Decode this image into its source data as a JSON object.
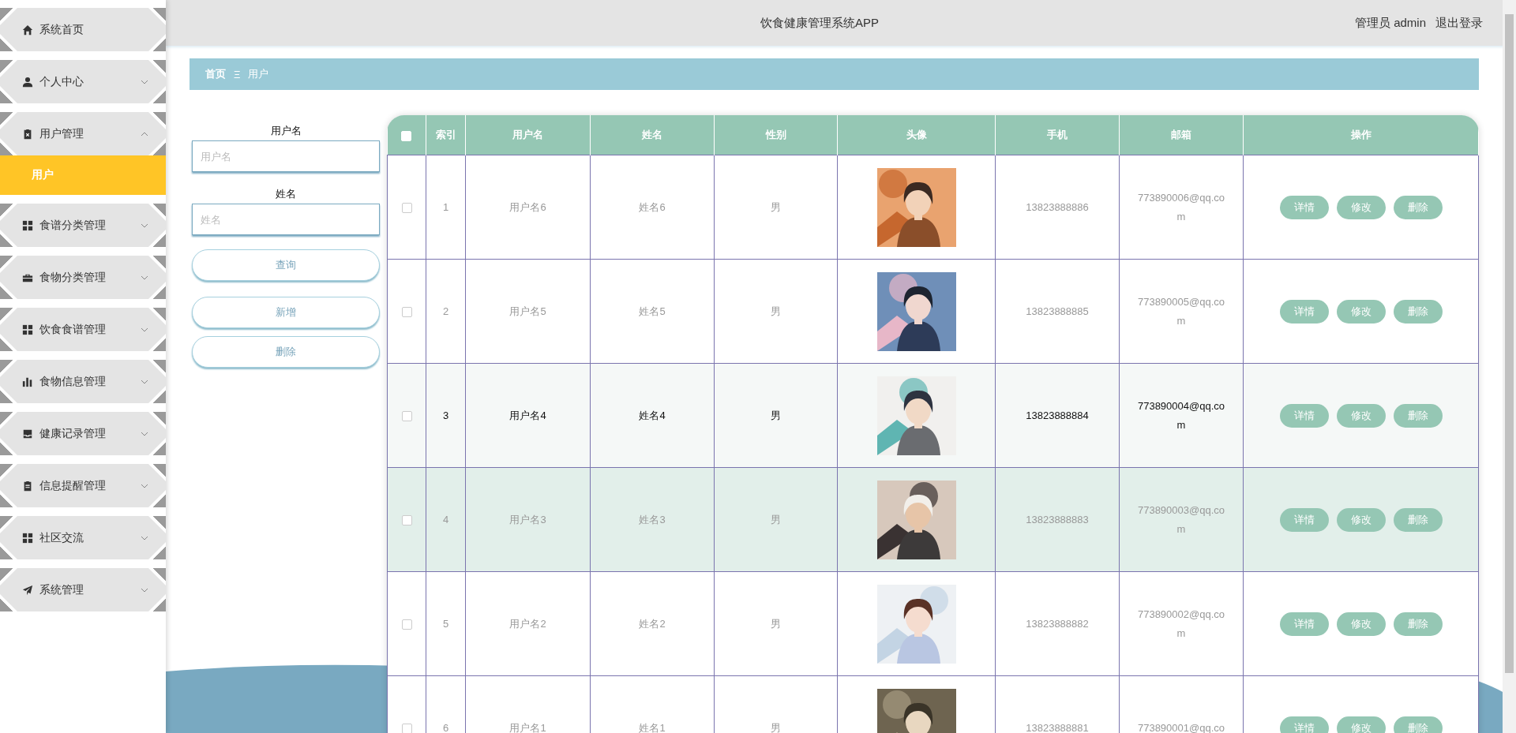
{
  "sidebar": {
    "items": [
      {
        "label": "系统首页",
        "kind": "link"
      },
      {
        "label": "个人中心",
        "kind": "group",
        "expanded": false
      },
      {
        "label": "用户管理",
        "kind": "group",
        "expanded": true,
        "children": [
          {
            "label": "用户",
            "selected": true
          }
        ]
      },
      {
        "label": "食谱分类管理",
        "kind": "group",
        "expanded": false
      },
      {
        "label": "食物分类管理",
        "kind": "group",
        "expanded": false
      },
      {
        "label": "饮食食谱管理",
        "kind": "group",
        "expanded": false
      },
      {
        "label": "食物信息管理",
        "kind": "group",
        "expanded": false
      },
      {
        "label": "健康记录管理",
        "kind": "group",
        "expanded": false
      },
      {
        "label": "信息提醒管理",
        "kind": "group",
        "expanded": false
      },
      {
        "label": "社区交流",
        "kind": "group",
        "expanded": false
      },
      {
        "label": "系统管理",
        "kind": "group",
        "expanded": false
      }
    ]
  },
  "header": {
    "title": "饮食健康管理系统APP",
    "user": "管理员 admin",
    "logout": "退出登录"
  },
  "breadcrumb": {
    "items": [
      "首页",
      "用户"
    ],
    "separator": "Ξ"
  },
  "search": {
    "fields": [
      {
        "label": "用户名",
        "placeholder": "用户名"
      },
      {
        "label": "姓名",
        "placeholder": "姓名"
      }
    ],
    "query_button": "查询",
    "add_button": "新增",
    "delete_button": "删除"
  },
  "table": {
    "select_all": {
      "checked": false
    },
    "columns": [
      "索引",
      "用户名",
      "姓名",
      "性别",
      "头像",
      "手机",
      "邮箱",
      "操作"
    ],
    "rows": [
      {
        "index": "1",
        "username": "用户名6",
        "name": "姓名6",
        "gender": "男",
        "phone": "13823888886",
        "email": "773890006@qq.com",
        "checked": false,
        "hovered": false,
        "shaded": false,
        "actions": [
          "详情",
          "修改",
          "删除"
        ]
      },
      {
        "index": "2",
        "username": "用户名5",
        "name": "姓名5",
        "gender": "男",
        "phone": "13823888885",
        "email": "773890005@qq.com",
        "checked": false,
        "hovered": false,
        "shaded": false,
        "actions": [
          "详情",
          "修改",
          "删除"
        ]
      },
      {
        "index": "3",
        "username": "用户名4",
        "name": "姓名4",
        "gender": "男",
        "phone": "13823888884",
        "email": "773890004@qq.com",
        "checked": false,
        "hovered": true,
        "shaded": false,
        "actions": [
          "详情",
          "修改",
          "删除"
        ]
      },
      {
        "index": "4",
        "username": "用户名3",
        "name": "姓名3",
        "gender": "男",
        "phone": "13823888883",
        "email": "773890003@qq.com",
        "checked": false,
        "hovered": false,
        "shaded": true,
        "actions": [
          "详情",
          "修改",
          "删除"
        ]
      },
      {
        "index": "5",
        "username": "用户名2",
        "name": "姓名2",
        "gender": "男",
        "phone": "13823888882",
        "email": "773890002@qq.com",
        "checked": false,
        "hovered": false,
        "shaded": false,
        "actions": [
          "详情",
          "修改",
          "删除"
        ]
      },
      {
        "index": "6",
        "username": "用户名1",
        "name": "姓名1",
        "gender": "男",
        "phone": "13823888881",
        "email": "773890001@qq.co",
        "checked": false,
        "hovered": false,
        "shaded": false,
        "actions": [
          "详情",
          "修改",
          "删除"
        ]
      }
    ]
  }
}
